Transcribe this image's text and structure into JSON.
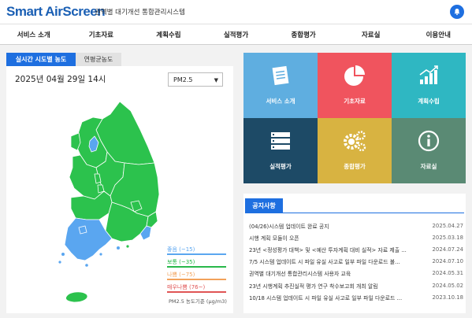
{
  "header": {
    "logo_prefix": "Smart ",
    "logo_air": "Air",
    "logo_suffix": "Screen",
    "subtitle": "권역별 대기개선 통합관리시스템"
  },
  "nav": [
    "서비스 소개",
    "기초자료",
    "계획수립",
    "실적평가",
    "종합평가",
    "자료실",
    "이용안내"
  ],
  "map_panel": {
    "tab_active": "실시간 시도별 농도",
    "tab_inactive": "연평균농도",
    "datetime": "2025년 04월 29일 14시",
    "pollutant_selected": "PM2.5",
    "legend": [
      {
        "label": "좋음 (~15)",
        "color": "#5aa6f0"
      },
      {
        "label": "보통 (~35)",
        "color": "#28b84a"
      },
      {
        "label": "나쁨 (~75)",
        "color": "#f2a25a"
      },
      {
        "label": "매우나쁨 (76~)",
        "color": "#e05555"
      }
    ],
    "legend_note": "PM2.5 농도기준 (μg/m3)",
    "colors": {
      "good": "#5aa6f0",
      "moderate": "#2cc24d"
    }
  },
  "tiles": [
    {
      "label": "서비스 소개",
      "color": "#5faee0",
      "icon": "document-icon"
    },
    {
      "label": "기초자료",
      "color": "#f0545e",
      "icon": "pie-chart-icon"
    },
    {
      "label": "계획수립",
      "color": "#2fb7c2",
      "icon": "bar-chart-icon"
    },
    {
      "label": "실적평가",
      "color": "#1d4a66",
      "icon": "list-icon"
    },
    {
      "label": "종합평가",
      "color": "#d8b341",
      "icon": "gears-icon"
    },
    {
      "label": "자료실",
      "color": "#5a8a74",
      "icon": "info-icon"
    }
  ],
  "notices": {
    "title": "공지사항",
    "items": [
      {
        "text": "(04/26)시스템 업데이트 완료 공지",
        "date": "2025.04.27"
      },
      {
        "text": "시행 계획 모듈이 오픈",
        "date": "2025.03.18"
      },
      {
        "text": "23년 <정성평가 대책> 및 <예산 투자계획 대비 실적> 자료 제출 ...",
        "date": "2024.07.24"
      },
      {
        "text": "7/5 시스템 업데이트 시 파일 유실 사고로 일부 파일 다운로드 불...",
        "date": "2024.07.10"
      },
      {
        "text": "권역별 대기개선 통합관리시스템 사용자 교육",
        "date": "2024.05.31"
      },
      {
        "text": "23년 시행계획 추진실적 평가 연구 착수보고회 개최 알림",
        "date": "2024.05.02"
      },
      {
        "text": "10/18 시스템 업데이트 시 파일 유실 사고로 일부 파일 다운로드 ...",
        "date": "2023.10.18"
      }
    ]
  }
}
